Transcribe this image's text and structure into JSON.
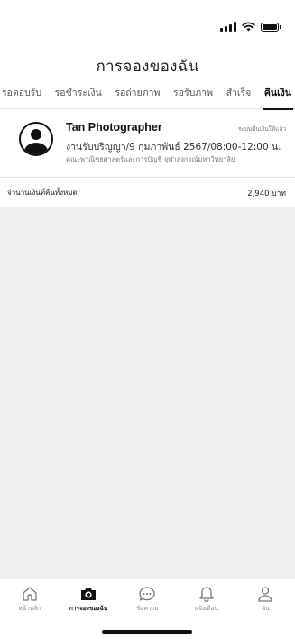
{
  "status_bar": {
    "icons": [
      "signal-icon",
      "wifi-icon",
      "battery-icon"
    ]
  },
  "header": {
    "title": "การจองของฉัน"
  },
  "tabs": [
    {
      "label": "รอตอบรับ",
      "active": false
    },
    {
      "label": "รอชำระเงิน",
      "active": false
    },
    {
      "label": "รอถ่ายภาพ",
      "active": false
    },
    {
      "label": "รอรับภาพ",
      "active": false
    },
    {
      "label": "สำเร็จ",
      "active": false
    },
    {
      "label": "คืนเงิน",
      "active": true
    }
  ],
  "booking": {
    "photographer": "Tan Photographer",
    "status": "ระบบคืนเงินให้แล้ว",
    "event_line": "งานรับปริญญา/9 กุมภาพันธ์ 2567/08:00-12:00 น.",
    "location": "คณะพาณิชยศาสตร์และการบัญชี จุฬาลงกรณ์มหาวิทยาลัย",
    "avatar_icon": "user-avatar-icon"
  },
  "summary": {
    "total_label": "จำนวนเงินที่คืนทั้งหมด",
    "total_value": "2,940 บาท"
  },
  "bottom_nav": [
    {
      "label": "หน้าหลัก",
      "icon": "home-icon",
      "active": false
    },
    {
      "label": "การจองของฉัน",
      "icon": "camera-icon",
      "active": true
    },
    {
      "label": "ข้อความ",
      "icon": "chat-icon",
      "active": false
    },
    {
      "label": "แจ้งเตือน",
      "icon": "bell-icon",
      "active": false
    },
    {
      "label": "ฉัน",
      "icon": "person-icon",
      "active": false
    }
  ]
}
